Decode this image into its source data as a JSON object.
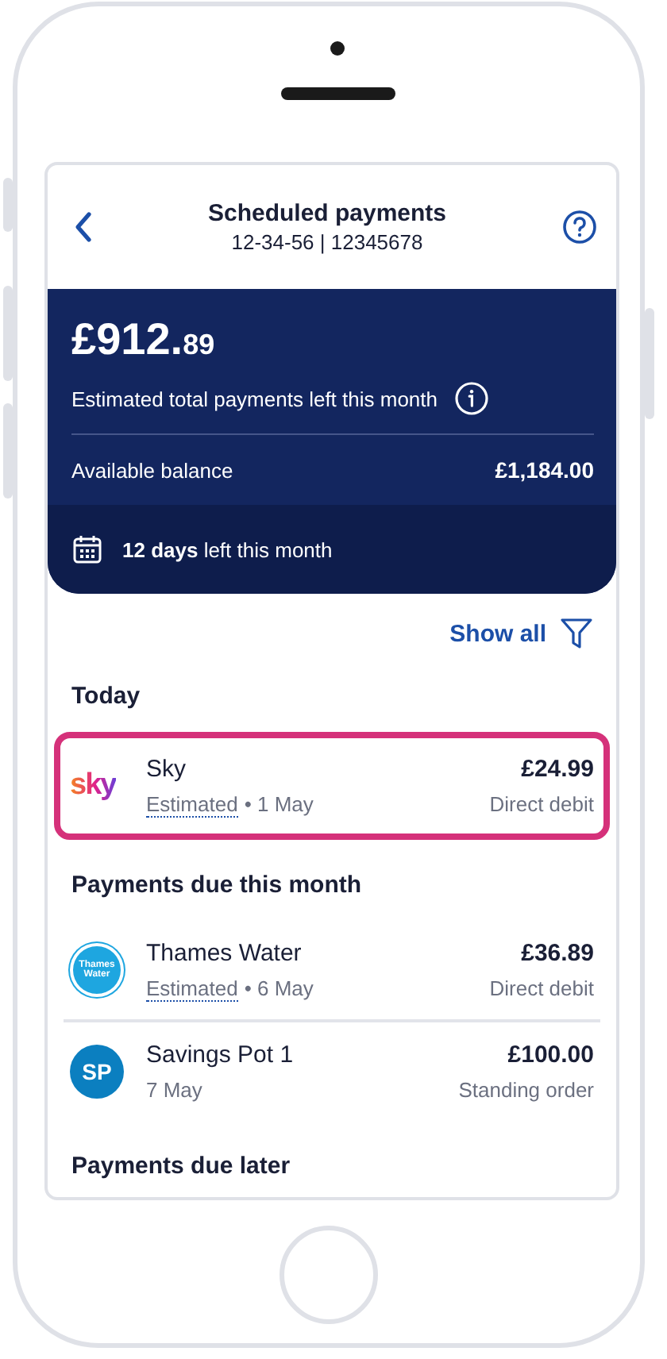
{
  "header": {
    "title": "Scheduled payments",
    "subtitle": "12-34-56 | 12345678"
  },
  "summary": {
    "amount_main": "£912.",
    "amount_pence": "89",
    "caption": "Estimated total payments left this month",
    "balance_label": "Available balance",
    "balance_value": "£1,184.00",
    "days_bold": "12 days",
    "days_rest": "left this month"
  },
  "show_all": "Show all",
  "sections": [
    {
      "title": "Today",
      "payments": [
        {
          "logo": {
            "kind": "sky",
            "text": "sky"
          },
          "name": "Sky",
          "amount": "£24.99",
          "estimated": "Estimated",
          "date": "• 1 May",
          "method": "Direct debit",
          "highlighted": true
        }
      ]
    },
    {
      "title": "Payments due this month",
      "payments": [
        {
          "logo": {
            "kind": "thames",
            "text": "Thames Water"
          },
          "name": "Thames Water",
          "amount": "£36.89",
          "estimated": "Estimated",
          "date": "• 6 May",
          "method": "Direct debit",
          "highlighted": false
        },
        {
          "logo": {
            "kind": "initials",
            "text": "SP"
          },
          "name": "Savings Pot 1",
          "amount": "£100.00",
          "date": "7 May",
          "method": "Standing order",
          "highlighted": false
        }
      ]
    },
    {
      "title": "Payments due later"
    }
  ]
}
